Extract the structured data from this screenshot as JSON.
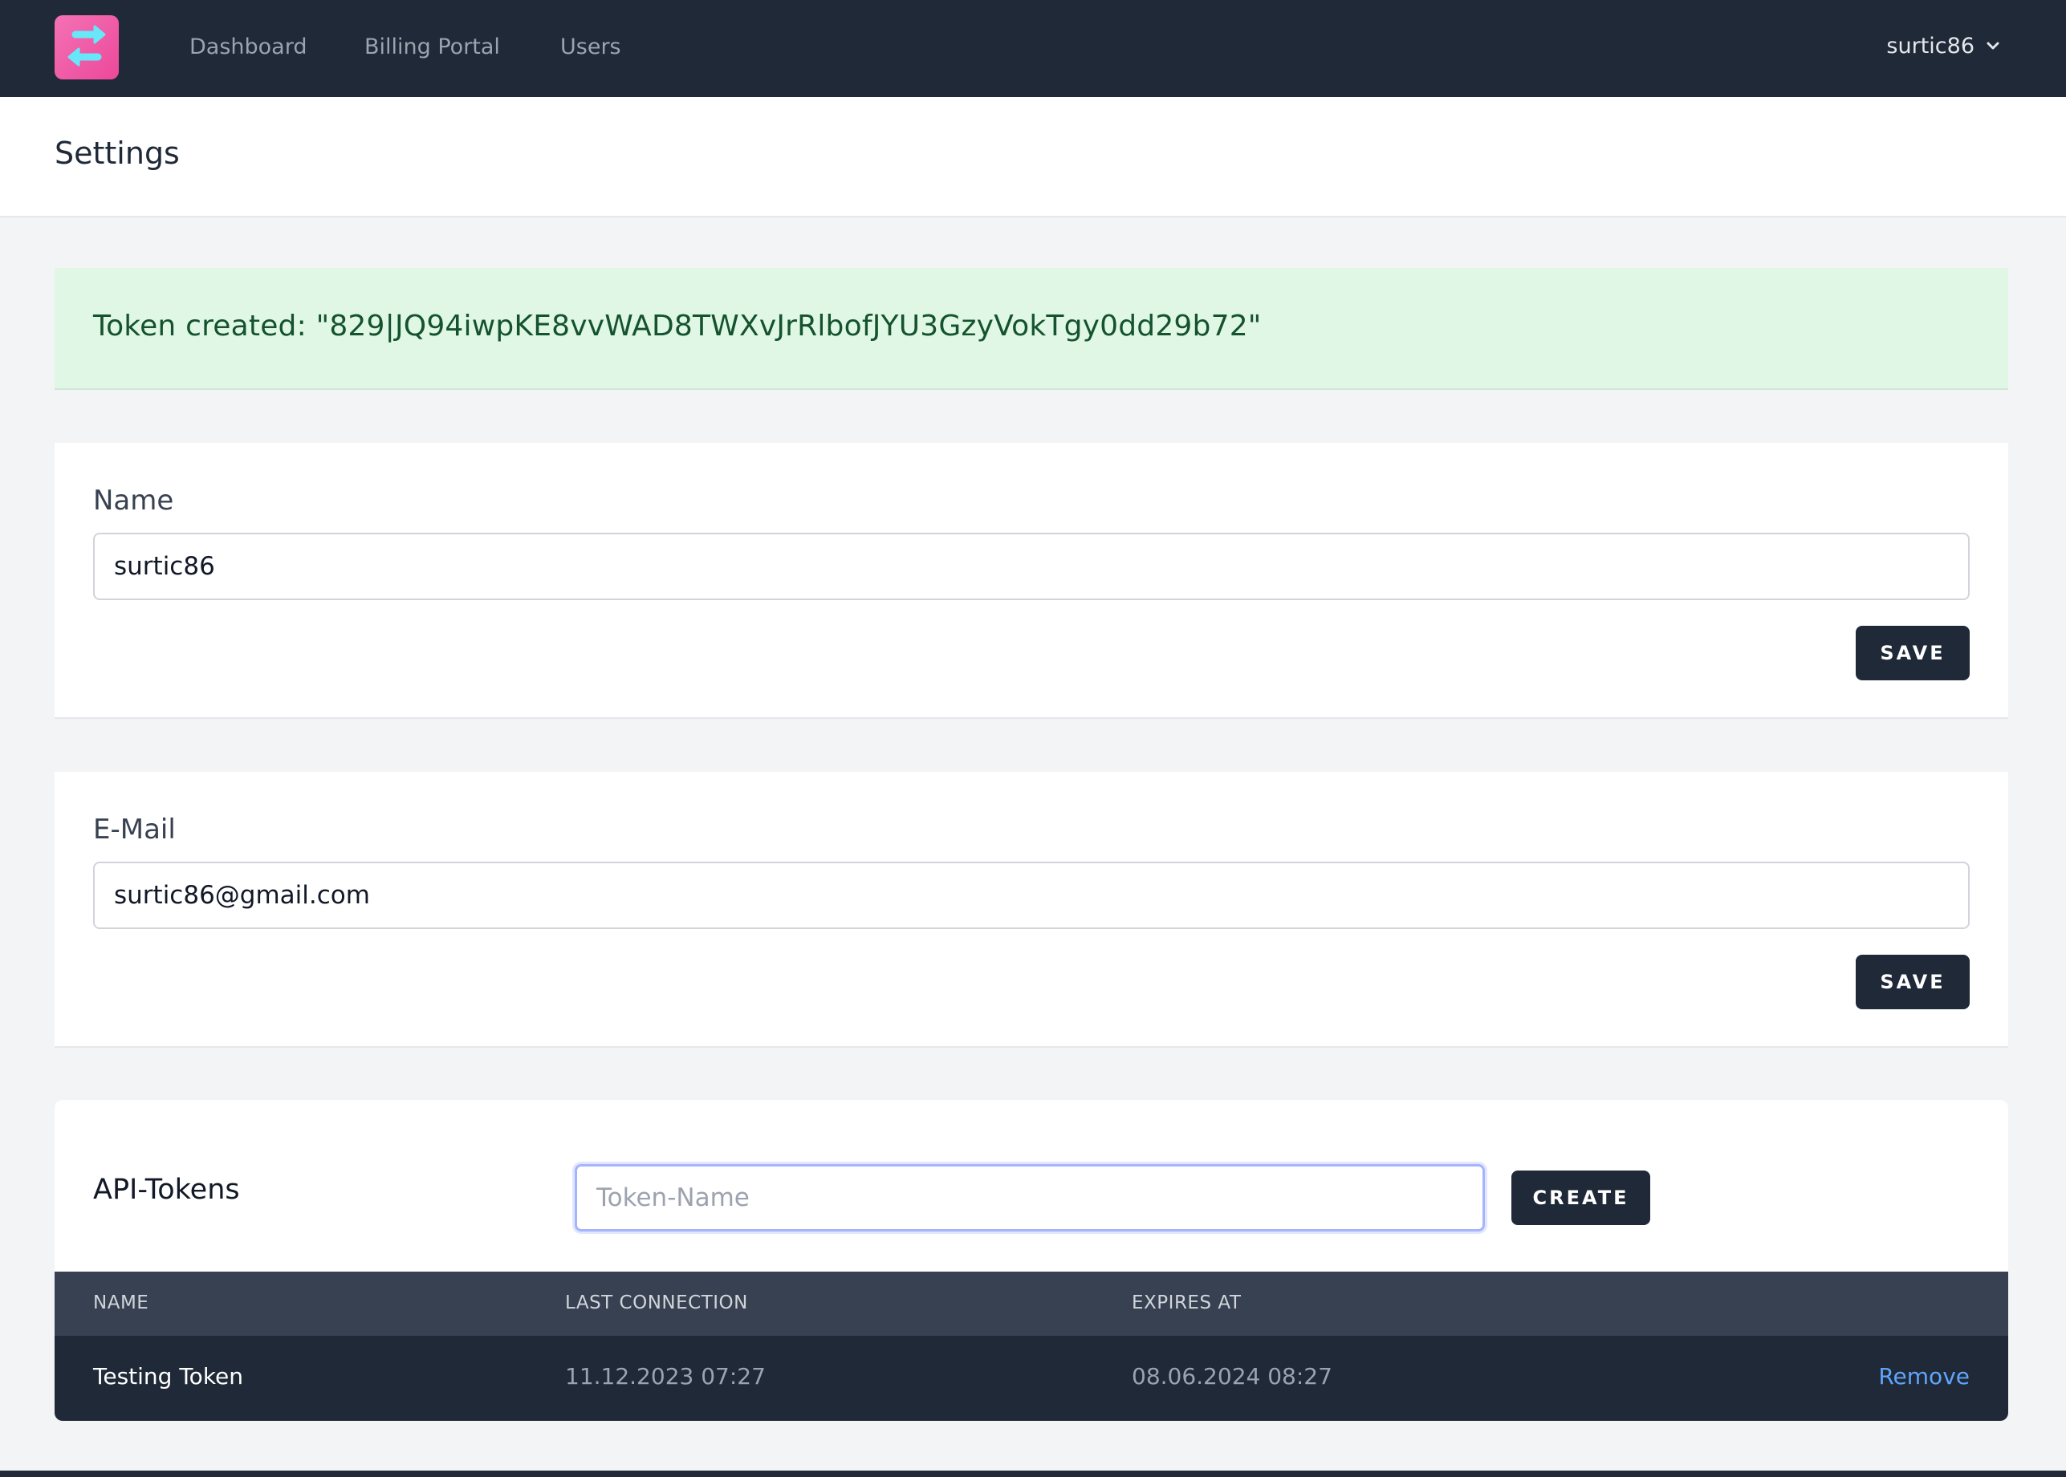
{
  "nav": {
    "links": [
      "Dashboard",
      "Billing Portal",
      "Users"
    ],
    "user": "surtic86",
    "logo_icon": "exchange-arrows-icon",
    "colors": {
      "bg": "#1f2937",
      "logo_bg": "#ec4899",
      "logo_arrows": "#67e8f9"
    }
  },
  "page": {
    "title": "Settings"
  },
  "alert": {
    "text": "Token created: \"829|JQ94iwpKE8vvWAD8TWXvJrRlbofJYU3GzyVokTgy0dd29b72\"",
    "colors": {
      "bg": "#e0f7e6",
      "text": "#14532d"
    }
  },
  "name_section": {
    "label": "Name",
    "value": "surtic86",
    "save_label": "SAVE"
  },
  "email_section": {
    "label": "E-Mail",
    "value": "surtic86@gmail.com",
    "save_label": "SAVE"
  },
  "api_tokens": {
    "title": "API-Tokens",
    "input_placeholder": "Token-Name",
    "input_value": "",
    "create_label": "CREATE",
    "columns": [
      "NAME",
      "LAST CONNECTION",
      "EXPIRES AT"
    ],
    "rows": [
      {
        "name": "Testing Token",
        "last_connection": "11.12.2023 07:27",
        "expires_at": "08.06.2024 08:27",
        "action": "Remove"
      }
    ],
    "colors": {
      "remove_link": "#60a5fa"
    }
  }
}
